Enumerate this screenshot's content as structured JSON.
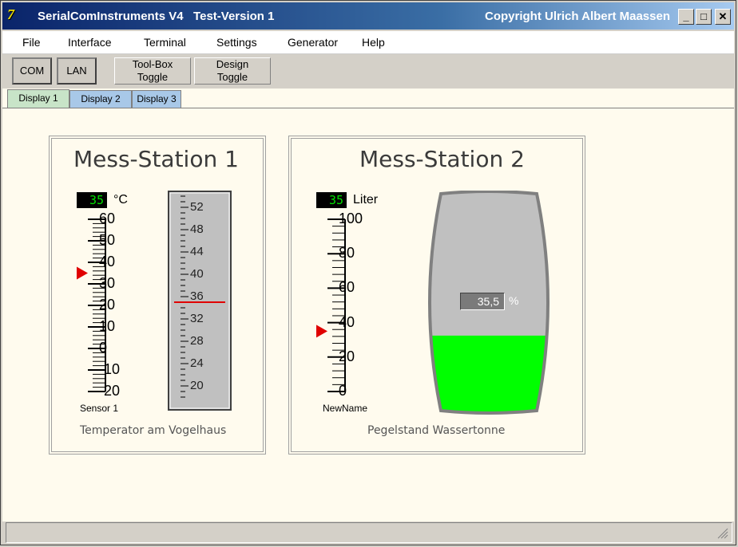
{
  "window": {
    "title": "SerialComInstruments V4   Test-Version 1",
    "copyright": "Copyright Ulrich Albert Maassen",
    "minimize_glyph": "_",
    "maximize_glyph": "□",
    "close_glyph": "✕",
    "icon_text": "7"
  },
  "menu": [
    {
      "label": "File"
    },
    {
      "label": "Interface"
    },
    {
      "label": "Terminal"
    },
    {
      "label": "Settings"
    },
    {
      "label": "Generator"
    },
    {
      "label": "Help"
    }
  ],
  "toolbar": {
    "com_label": "COM",
    "lan_label": "LAN",
    "toolbox_line1": "Tool-Box",
    "toolbox_line2": "Toggle",
    "design_line1": "Design",
    "design_line2": "Toggle"
  },
  "tabs": [
    {
      "label": "Display 1",
      "active": true,
      "color": "#c8e4c8"
    },
    {
      "label": "Display 2",
      "active": false,
      "color": "#a8c8e8"
    },
    {
      "label": "Display 3",
      "active": false,
      "color": "#a8c8e8"
    }
  ],
  "station1": {
    "title": "Mess-Station 1",
    "caption": "Temperator am Vogelhaus",
    "display_value": "35",
    "unit": "°C",
    "sensor_name": "Sensor 1",
    "scale_labels": [
      "60",
      "50",
      "40",
      "30",
      "20",
      "10",
      "0",
      "-10",
      "-20"
    ],
    "scale_min": -20,
    "scale_max": 60,
    "value": 35,
    "drum_labels": [
      "52",
      "48",
      "44",
      "40",
      "36",
      "32",
      "28",
      "24",
      "20"
    ],
    "drum_value": 35,
    "marker_color": "#e00000"
  },
  "station2": {
    "title": "Mess-Station 2",
    "caption": "Pegelstand Wassertonne",
    "display_value": "35",
    "unit": "Liter",
    "sensor_name": "NewName",
    "scale_labels": [
      "100",
      "80",
      "60",
      "40",
      "20",
      "0"
    ],
    "scale_min": 0,
    "scale_max": 100,
    "value": 35,
    "tank_percent_text": "35,5",
    "tank_percent_unit": "%",
    "tank_level": 0.355,
    "fill_color": "#00ff00",
    "empty_color": "#c0c0c0"
  }
}
